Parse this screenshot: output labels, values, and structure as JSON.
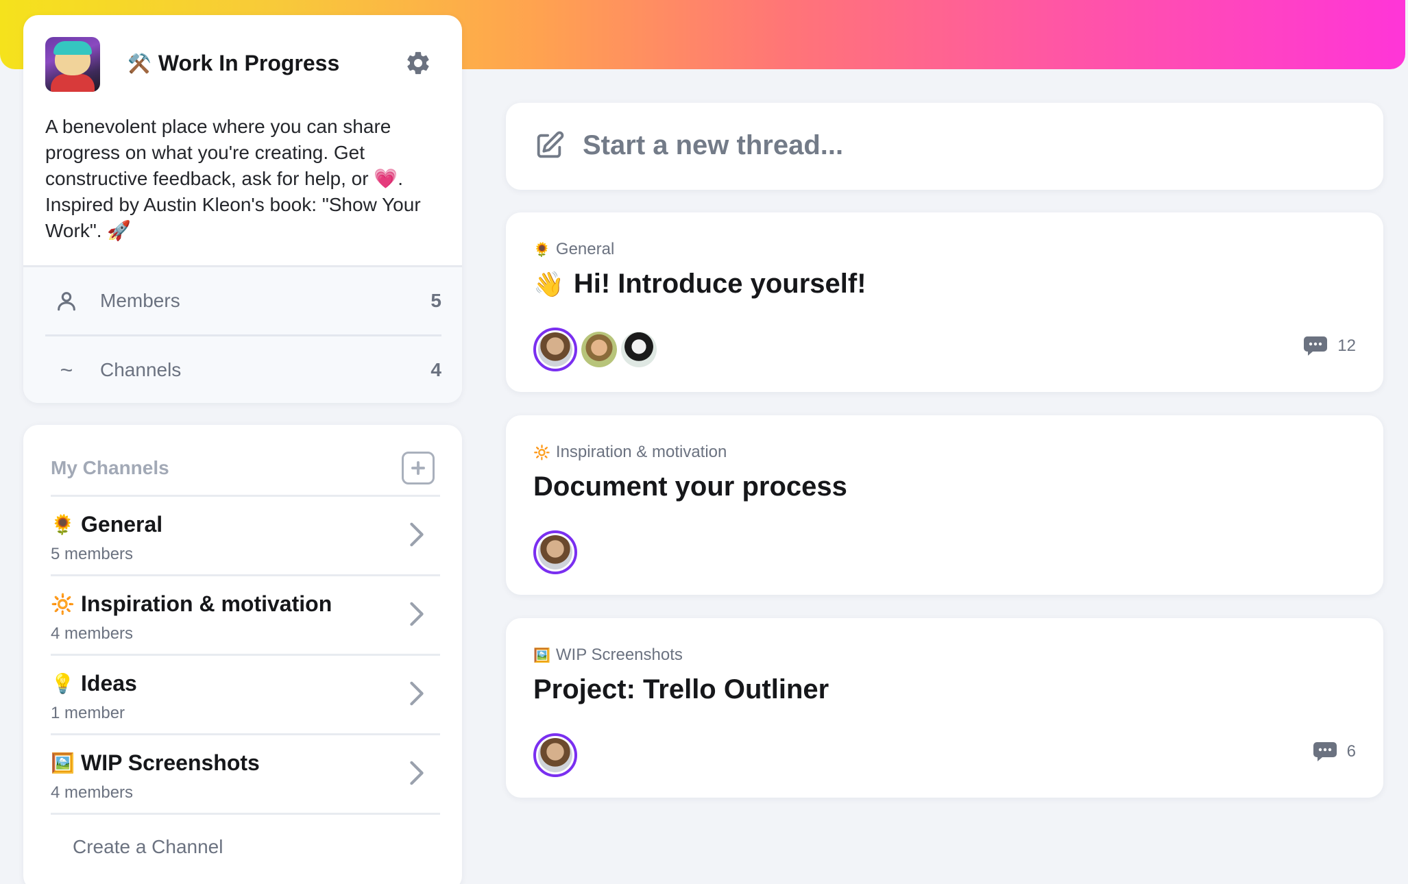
{
  "community": {
    "title_emoji": "⚒️",
    "title": "Work In Progress",
    "description": "A benevolent place where you can share progress on what you're creating. Get constructive feedback, ask for help, or 💗. Inspired by Austin Kleon's book: \"Show Your Work\". 🚀",
    "stats": [
      {
        "label": "Members",
        "count": "5",
        "icon": "user-icon"
      },
      {
        "label": "Channels",
        "count": "4",
        "icon": "tilde-icon"
      }
    ]
  },
  "my_channels": {
    "title": "My Channels",
    "items": [
      {
        "emoji": "🌻",
        "name": "General",
        "members": "5 members"
      },
      {
        "emoji": "🔆",
        "name": "Inspiration & motivation",
        "members": "4 members"
      },
      {
        "emoji": "💡",
        "name": "Ideas",
        "members": "1 member"
      },
      {
        "emoji": "🖼️",
        "name": "WIP Screenshots",
        "members": "4 members"
      }
    ],
    "create_label": "Create a Channel"
  },
  "composer": {
    "placeholder": "Start a new thread..."
  },
  "threads": [
    {
      "channel_emoji": "🌻",
      "channel": "General",
      "title_emoji": "👋",
      "title": "Hi! Introduce yourself!",
      "comments": "12"
    },
    {
      "channel_emoji": "🔆",
      "channel": "Inspiration & motivation",
      "title_emoji": "",
      "title": "Document your process",
      "comments": ""
    },
    {
      "channel_emoji": "🖼️",
      "channel": "WIP Screenshots",
      "title_emoji": "",
      "title": "Project: Trello Outliner",
      "comments": "6"
    }
  ],
  "colors": {
    "accent_ring": "#7a2ff0",
    "banner_gradient": [
      "#f5e21c",
      "#ffa34f",
      "#ff7577",
      "#ff35d8"
    ]
  }
}
